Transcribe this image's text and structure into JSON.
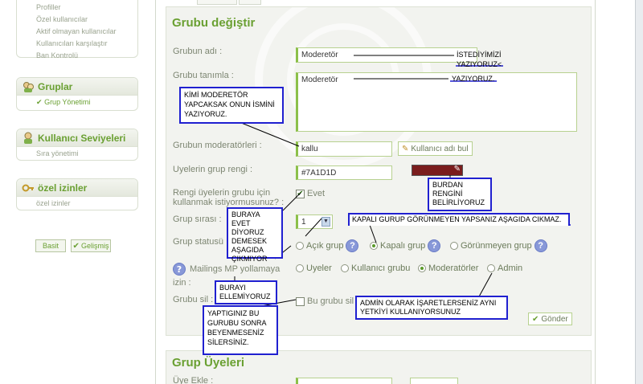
{
  "sidebar": {
    "top_items": [
      "Profiller",
      "Özel kullanıcılar",
      "Aktif olmayan kullanıcılar",
      "Kullanıcıları karşılaştır",
      "Ban Kontrolü"
    ],
    "groups_title": "Gruplar",
    "groups_item": "Grup Yönetimi",
    "levels_title": "Kullanıcı Seviyeleri",
    "levels_item": "Sıra yönetimi",
    "perms_title": "özel izinler",
    "perms_item": "özel izinler",
    "btn_basic": "Basit",
    "btn_advanced": "Gelişmiş"
  },
  "form": {
    "title": "Grubu değiştir",
    "name_label": "Grubun adı :",
    "name_value": "Moderetör",
    "desc_label": "Grubu tanımla :",
    "desc_value": "Moderetör",
    "mods_label": "Grubun moderatörleri :",
    "mods_value": "kallu",
    "find_user_btn": "Kullanıcı adı bul",
    "color_label": "Uyelerin grup rengi :",
    "color_value": "#7A1D1D",
    "color_swatch": "#7A1D1D",
    "usecolor_label_1": "Rengi üyelerin grubu için",
    "usecolor_label_2": "kullanmak istiyormusunuz? :",
    "usecolor_value": "Evet",
    "order_label": "Grup sırası :",
    "order_value": "1",
    "status_label": "Grup statusü :",
    "status_options": [
      "Açık grup",
      "Kapalı grup",
      "Görünmeyen grup"
    ],
    "mail_label_1": "Mailings MP yollamaya",
    "mail_label_2": "izin :",
    "mail_options": [
      "Uyeler",
      "Kullanıcı grubu",
      "Moderatörler",
      "Admin"
    ],
    "delete_label": "Grubu sil :",
    "delete_text": "Bu grubu sil",
    "submit": "Gönder",
    "members_title": "Grup Üyeleri",
    "add_member_label": "Üye Ekle :"
  },
  "annotations": {
    "n1": [
      "İSTEDİYİMİZİ",
      "YAZIYORUZ<"
    ],
    "n2": "YAZIYORUZ.",
    "n3": [
      "KİMİ MODERETÖR",
      "YAPCAKSAK ONUN İSMİNİ",
      "YAZIYORUZ."
    ],
    "n4": [
      "BURDAN",
      "RENGİNİ",
      "BELİRLİYORUZ"
    ],
    "n5": [
      "BURAYA EVET",
      "DİYORUZ",
      "DEMESEK",
      "AŞAGIDA",
      "ÇIKMIYOR"
    ],
    "n6": "KAPALI GURUP GÖRÜNMEYEN YAPSANIZ AŞAGIDA CIKMAZ.",
    "n7": [
      "BURAYI",
      "ELLEMİYORUZ"
    ],
    "n8": [
      "ADMİN OLARAK İŞARETLERSENİZ AYNI",
      "YETKİYİ KULLANIYORSUNUZ"
    ],
    "n9": [
      "YAPTIGINIZ BU",
      "GURUBU SONRA",
      "BEYENMESENİZ",
      "SİLERSİNİZ."
    ]
  },
  "colors": {
    "accent": "#6aa032",
    "annotation_border": "#2020d0"
  }
}
